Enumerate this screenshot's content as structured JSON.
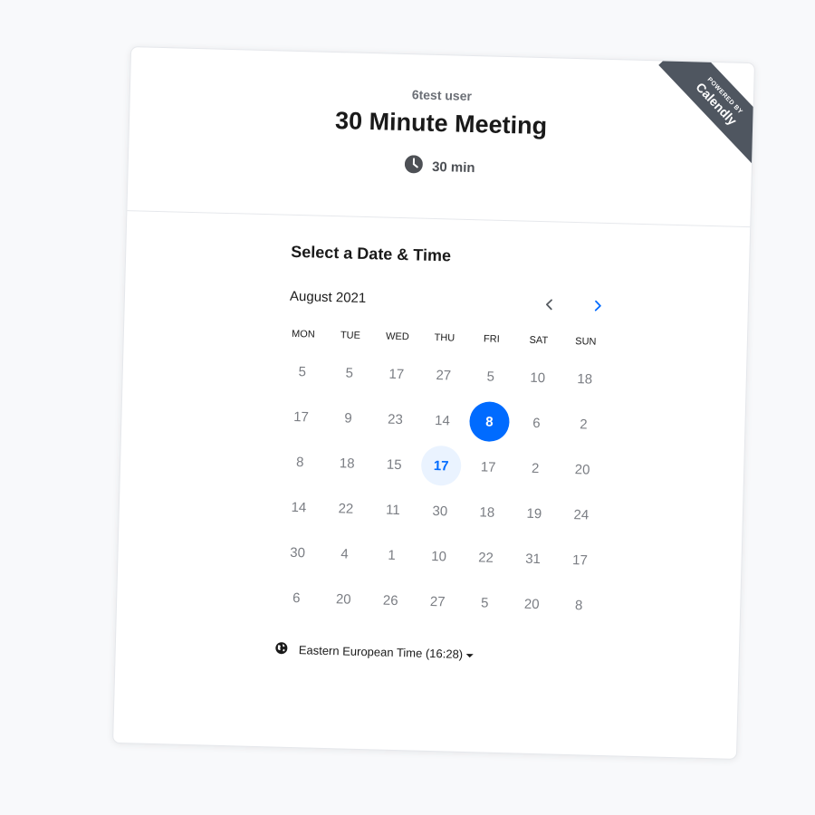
{
  "badge": {
    "powered_by": "POWERED BY",
    "brand": "Calendly"
  },
  "header": {
    "owner": "6test user",
    "event_title": "30 Minute Meeting",
    "duration": "30 min",
    "duration_icon": "clock-icon"
  },
  "scheduler": {
    "title": "Select a Date & Time",
    "month": "August 2021",
    "prev_icon": "chevron-left-icon",
    "next_icon": "chevron-right-icon",
    "weekdays": [
      "MON",
      "TUE",
      "WED",
      "THU",
      "FRI",
      "SAT",
      "SUN"
    ],
    "days": [
      "5",
      "5",
      "17",
      "27",
      "5",
      "10",
      "18",
      "17",
      "9",
      "23",
      "14",
      "8",
      "6",
      "2",
      "8",
      "18",
      "15",
      "17",
      "17",
      "2",
      "20",
      "14",
      "22",
      "11",
      "30",
      "18",
      "19",
      "24",
      "30",
      "4",
      "1",
      "10",
      "22",
      "31",
      "17",
      "6",
      "20",
      "26",
      "27",
      "5",
      "20",
      "8"
    ],
    "selected_day": "8",
    "available_day": "17",
    "timezone": "Eastern European Time (16:28)",
    "timezone_icon": "globe-icon"
  },
  "colors": {
    "accent": "#006bff",
    "available_bg": "#eaf3ff",
    "badge_bg": "#4f5660",
    "muted_text": "#7a7d83"
  }
}
